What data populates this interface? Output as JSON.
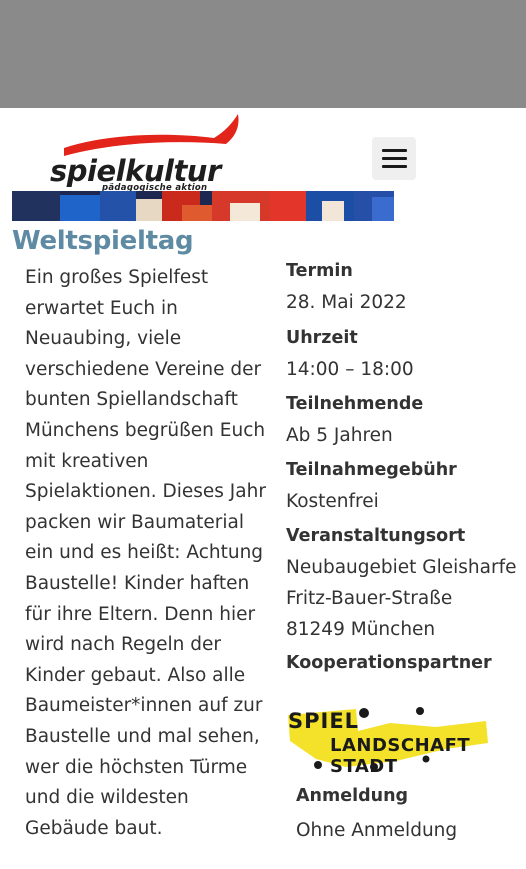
{
  "header": {
    "logo_word": "spielkultur",
    "logo_tagline": "pädagogische aktion",
    "brand_red": "#e3241b"
  },
  "page": {
    "title": "Weltspieltag",
    "title_color": "#5e8aa3",
    "description_lines": [
      "Ein großes Spielfest",
      "erwartet Euch in",
      "Neuaubing, viele",
      "verschiedene Vereine der",
      "bunten Spiellandschaft",
      "Münchens begrüßen Euch",
      "mit kreativen",
      "Spielaktionen. Dieses Jahr",
      "packen wir Baumaterial",
      "ein und es heißt: Achtung",
      "Baustelle! Kinder haften",
      "für ihre Eltern. Denn hier",
      "wird nach Regeln der",
      "Kinder gebaut. Also alle",
      "Baumeister*innen auf zur",
      "Baustelle und mal sehen,",
      "wer die höchsten Türme",
      "und die wildesten",
      "Gebäude baut."
    ]
  },
  "details": {
    "termin_label": "Termin",
    "termin_value": "28. Mai 2022",
    "uhrzeit_label": "Uhrzeit",
    "uhrzeit_value": "14:00 – 18:00",
    "teilnehmende_label": "Teilnehmende",
    "teilnehmende_value": "Ab 5 Jahren",
    "gebuehr_label": "Teilnahmegebühr",
    "gebuehr_value": "Kostenfrei",
    "ort_label": "Veranstaltungsort",
    "ort_line1": "Neubaugebiet Gleisharfe",
    "ort_line2": "Fritz-Bauer-Straße",
    "ort_line3": "81249 München",
    "partner_label": "Kooperationspartner",
    "partner_logo_text1": "SPIEL",
    "partner_logo_text2": "LANDSCHAFT STADT",
    "partner_logo_color": "#f4e22a",
    "anmeldung_label": "Anmeldung",
    "anmeldung_value": "Ohne Anmeldung"
  }
}
